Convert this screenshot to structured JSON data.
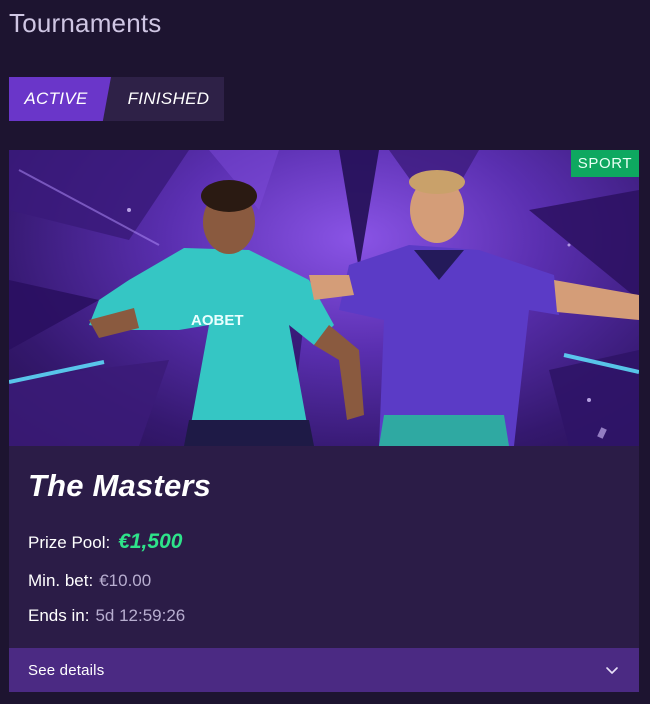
{
  "page": {
    "title": "Tournaments"
  },
  "tabs": [
    {
      "label": "ACTIVE",
      "selected": true
    },
    {
      "label": "FINISHED",
      "selected": false
    }
  ],
  "tournament": {
    "badge": "SPORT",
    "banner_image": "two-football-players-purple-background",
    "banner_shirt_text": "AOBET",
    "name": "The Masters",
    "prize_label": "Prize Pool:",
    "prize_value": "€1,500",
    "min_bet_label": "Min. bet:",
    "min_bet_value": "€10.00",
    "ends_label": "Ends in:",
    "ends_value": "5d 12:59:26",
    "details_label": "See details"
  },
  "colors": {
    "background": "#1d1430",
    "active_tab": "#6a36c9",
    "badge": "#0ea860",
    "prize": "#2ee38a",
    "details_bar": "#4b2a83"
  }
}
